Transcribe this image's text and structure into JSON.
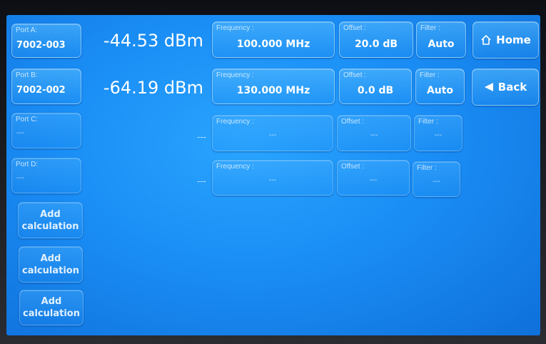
{
  "ports": [
    {
      "label": "Port A:",
      "value": "7002-003",
      "reading": "-44.53 dBm",
      "frequency": "100.000 MHz",
      "offset": "20.0 dB",
      "filter": "Auto"
    },
    {
      "label": "Port B:",
      "value": "7002-002",
      "reading": "-64.19 dBm",
      "frequency": "130.000 MHz",
      "offset": "0.0 dB",
      "filter": "Auto"
    },
    {
      "label": "Port C:",
      "value": "---",
      "reading": "---",
      "frequency": "---",
      "offset": "---",
      "filter": "---"
    },
    {
      "label": "Port D:",
      "value": "---",
      "reading": "---",
      "frequency": "---",
      "offset": "---",
      "filter": "---"
    }
  ],
  "field_labels": {
    "frequency": "Frequency :",
    "offset": "Offset :",
    "filter": "Filter :"
  },
  "calculations": [
    {
      "line1": "Add",
      "line2": "calculation"
    },
    {
      "line1": "Add",
      "line2": "calculation"
    },
    {
      "line1": "Add",
      "line2": "calculation"
    }
  ],
  "nav": {
    "home_label": "Home",
    "home_icon": "home-icon",
    "back_label": "Back",
    "back_icon": "back-arrow-icon"
  },
  "colors": {
    "screen": "#1a8ef5",
    "text": "#ffffff",
    "button_border": "#c8ebff"
  }
}
